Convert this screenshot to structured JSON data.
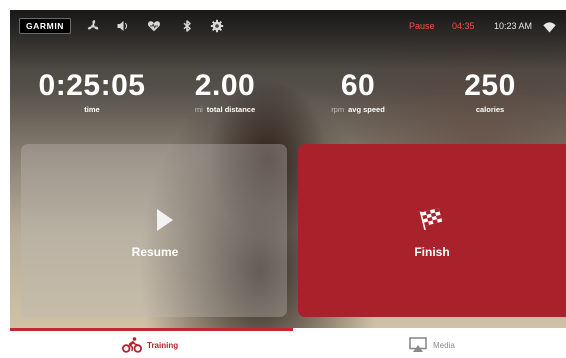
{
  "status_bar": {
    "logo_text": "GARMIN",
    "icons": [
      "fan-icon",
      "volume-icon",
      "heart-rate-icon",
      "bluetooth-icon",
      "gear-icon"
    ],
    "pause_label": "Pause",
    "pause_time": "04:35",
    "clock": "10:23 AM",
    "wifi_icon": "wifi-icon"
  },
  "metrics": {
    "time": {
      "value": "0:25:05",
      "label": "time"
    },
    "distance": {
      "value": "2.00",
      "unit": "mi",
      "label": "total distance"
    },
    "speed": {
      "value": "60",
      "unit": "rpm",
      "label": "avg speed"
    },
    "calories": {
      "value": "250",
      "label": "calories"
    }
  },
  "actions": {
    "resume": {
      "label": "Resume",
      "icon": "play-icon"
    },
    "finish": {
      "label": "Finish",
      "icon": "checkered-flag-icon"
    }
  },
  "tabs": [
    {
      "label": "Training",
      "icon": "cycling-icon",
      "active": true
    },
    {
      "label": "Media",
      "icon": "screen-mirror-icon",
      "active": false
    }
  ],
  "colors": {
    "accent_red": "#a9222b",
    "active_tab": "#c8262f",
    "pause_text": "#ff4a4a"
  }
}
